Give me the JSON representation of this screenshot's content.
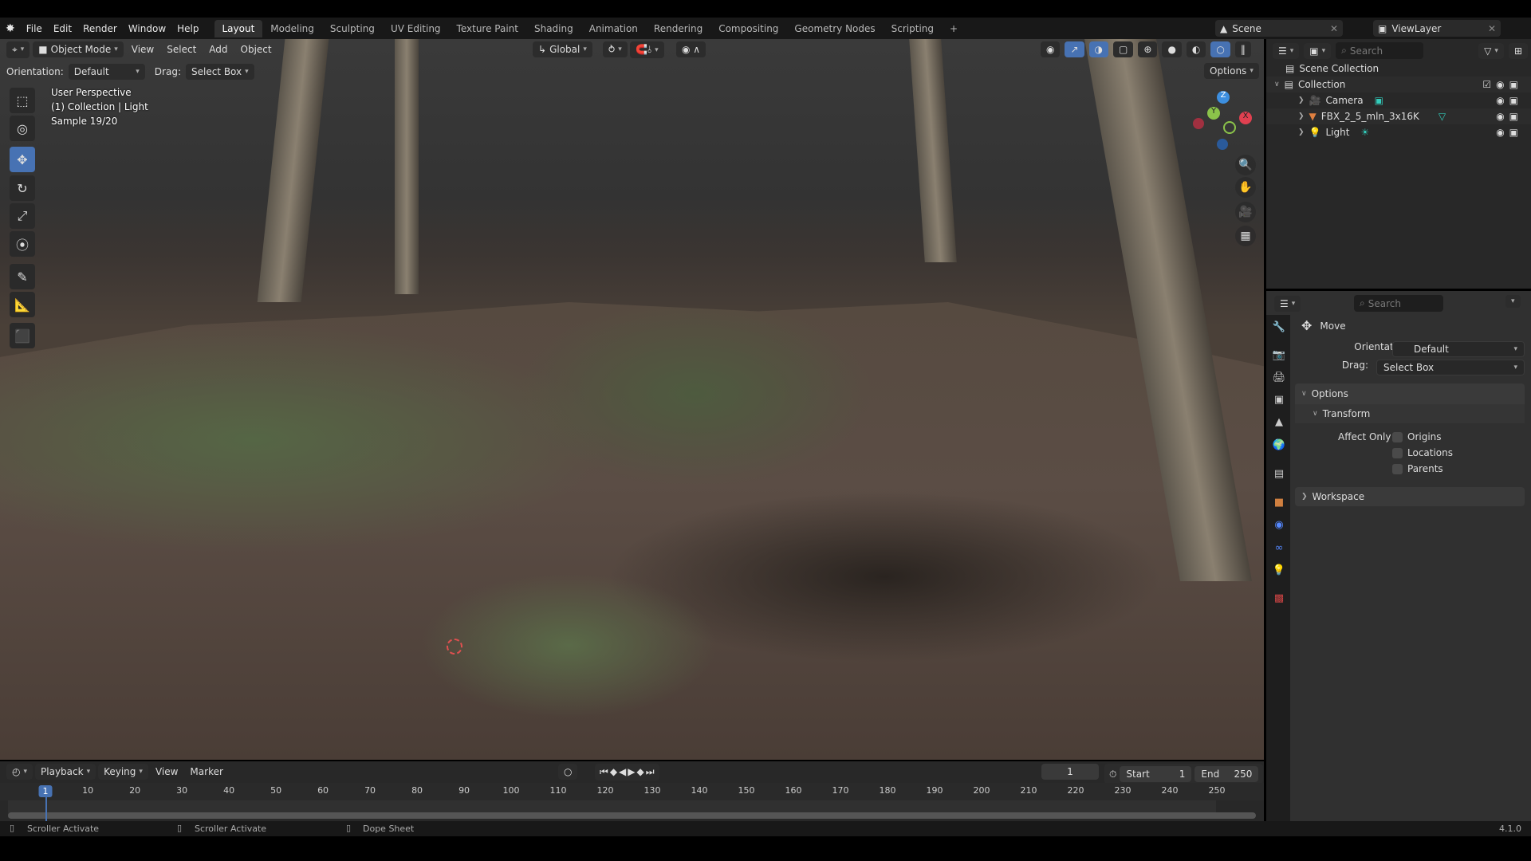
{
  "menubar": {
    "menus": [
      "File",
      "Edit",
      "Render",
      "Window",
      "Help"
    ],
    "workspaces": [
      "Layout",
      "Modeling",
      "Sculpting",
      "UV Editing",
      "Texture Paint",
      "Shading",
      "Animation",
      "Rendering",
      "Compositing",
      "Geometry Nodes",
      "Scripting"
    ],
    "add_tab": "+",
    "scene": "Scene",
    "view_layer": "ViewLayer"
  },
  "viewport": {
    "mode": "Object Mode",
    "menus": [
      "View",
      "Select",
      "Add",
      "Object"
    ],
    "transform_orientation": "Global",
    "orientation_label": "Orientation:",
    "orientation_value": "Default",
    "drag_label": "Drag:",
    "drag_value": "Select Box",
    "options": "Options",
    "overlay": [
      "User Perspective",
      "(1) Collection | Light",
      "Sample 19/20"
    ],
    "gizmo": {
      "x": "X",
      "y": "Y",
      "z": "Z"
    }
  },
  "outliner": {
    "search_placeholder": "Search",
    "root": "Scene Collection",
    "collection": "Collection",
    "items": [
      {
        "name": "Camera"
      },
      {
        "name": "FBX_2_5_mln_3x16K"
      },
      {
        "name": "Light"
      }
    ]
  },
  "properties": {
    "search_placeholder": "Search",
    "tool": "Move",
    "orientation_label": "Orientation",
    "orientation_value": "Default",
    "drag_label": "Drag:",
    "drag_value": "Select Box",
    "options": "Options",
    "transform": "Transform",
    "affect_only": "Affect Only",
    "checkboxes": [
      "Origins",
      "Locations",
      "Parents"
    ],
    "workspace": "Workspace"
  },
  "timeline": {
    "menus": [
      "Playback",
      "Keying",
      "View",
      "Marker"
    ],
    "current_frame": "1",
    "start_label": "Start",
    "start": "1",
    "end_label": "End",
    "end": "250",
    "ticks": [
      "1",
      "10",
      "20",
      "30",
      "40",
      "50",
      "60",
      "70",
      "80",
      "90",
      "100",
      "110",
      "120",
      "130",
      "140",
      "150",
      "160",
      "170",
      "180",
      "190",
      "200",
      "210",
      "220",
      "230",
      "240",
      "250"
    ]
  },
  "statusbar": {
    "items": [
      "Scroller Activate",
      "Scroller Activate",
      "Dope Sheet"
    ],
    "version": "4.1.0"
  },
  "colors": {
    "accent": "#4772b3",
    "x_axis": "#e04050",
    "y_axis": "#8bc34a",
    "z_axis": "#3d8fe0"
  }
}
